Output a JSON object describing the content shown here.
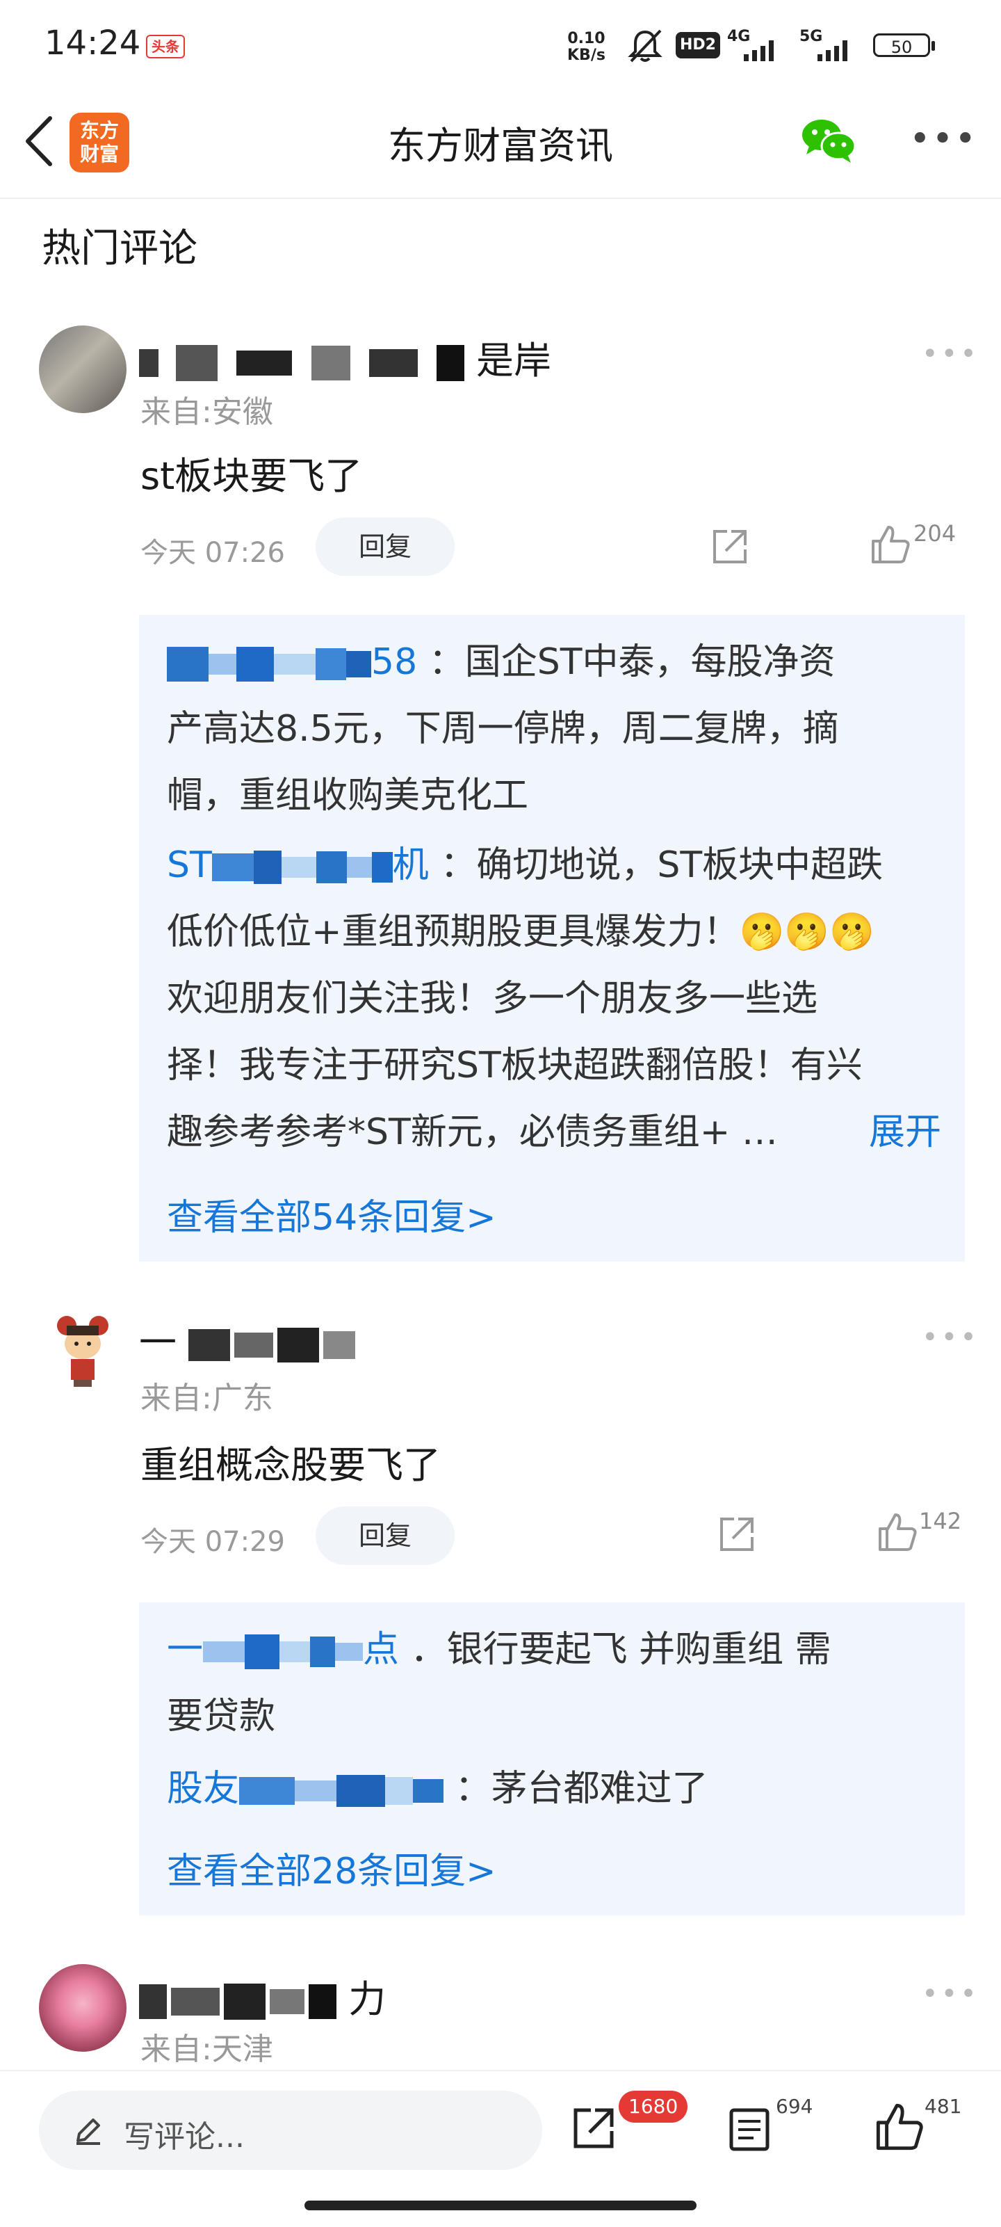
{
  "status_bar": {
    "time": "14:24",
    "app_badge": "头条",
    "net_speed_value": "0.10",
    "net_speed_unit": "KB/s",
    "hd": "HD2",
    "sig1": "4G",
    "sig2": "5G",
    "battery": "50"
  },
  "nav": {
    "logo_line1": "东方",
    "logo_line2": "财富",
    "title": "东方财富资讯"
  },
  "section_title": "热门评论",
  "comments": [
    {
      "name_visible": "是岸",
      "from": "来自:安徽",
      "content": "st板块要飞了",
      "time": "今天 07:26",
      "reply_label": "回复",
      "likes": "204",
      "replies": [
        {
          "name_visible": "58",
          "sep": "：",
          "lines": [
            "国企ST中泰，每股净资",
            "产高达8.5元，下周一停牌，周二复牌，摘",
            "帽，重组收购美克化工"
          ]
        },
        {
          "name_visible": "ST",
          "name_tail": "机",
          "sep": "：",
          "lines": [
            "确切地说，ST板块中超跌",
            "低价低位+重组预期股更具爆发力！🫢🫢🫢",
            "欢迎朋友们关注我！多一个朋友多一些选",
            "择！我专注于研究ST板块超跌翻倍股！有兴",
            "趣参考参考*ST新元，必债务重组+ …"
          ],
          "expand": "展开"
        }
      ],
      "view_all": "查看全部54条回复>"
    },
    {
      "name_visible": "一",
      "from": "来自:广东",
      "content": "重组概念股要飞了",
      "time": "今天 07:29",
      "reply_label": "回复",
      "likes": "142",
      "replies": [
        {
          "name_visible": "一",
          "name_tail": "点",
          "sep": "．",
          "lines": [
            "银行要起飞  并购重组 需",
            "要贷款"
          ]
        },
        {
          "name_visible": "股友",
          "sep": "：",
          "lines": [
            "茅台都难过了"
          ]
        }
      ],
      "view_all": "查看全部28条回复>"
    },
    {
      "name_visible": "力",
      "from": "来自:天津"
    }
  ],
  "bottom_bar": {
    "write_placeholder": "写评论...",
    "share_count": "1680",
    "comment_count": "694",
    "like_count": "481"
  },
  "colors": {
    "link_blue": "#1677d9",
    "reply_bg": "#f1f6fc",
    "badge_red": "#e53935",
    "logo_orange": "#f26a21",
    "wechat_green": "#2dc100"
  },
  "icons": [
    "back-arrow-icon",
    "wechat-icon",
    "more-icon",
    "share-icon",
    "thumb-up-icon",
    "pencil-icon",
    "comment-list-icon"
  ]
}
